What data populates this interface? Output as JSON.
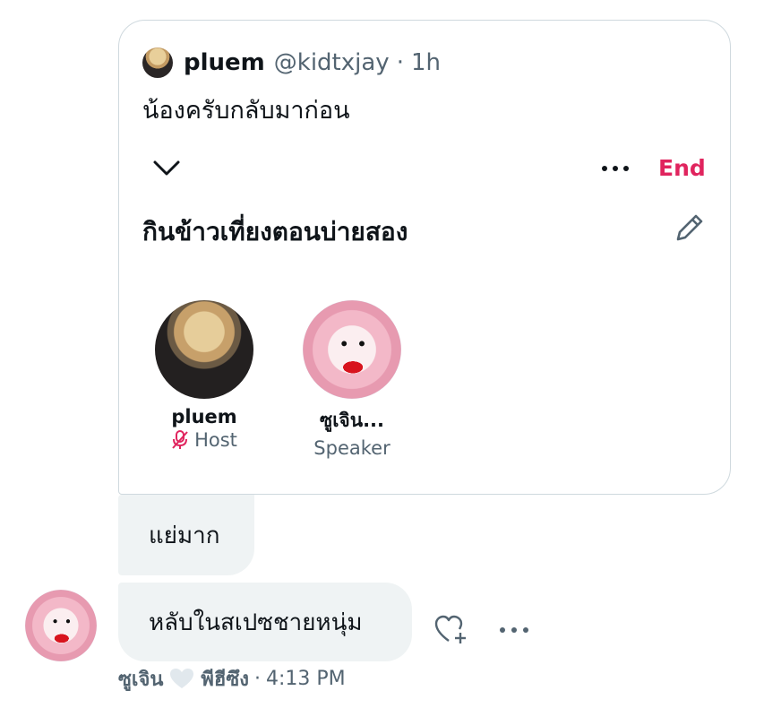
{
  "quoted_tweet": {
    "author_name": "pluem",
    "author_handle": "@kidtxjay",
    "separator": "·",
    "time": "1h",
    "text": "น้องครับกลับมาก่อน"
  },
  "space": {
    "end_label": "End",
    "title": "กินข้าวเที่ยงตอนบ่ายสอง",
    "participants": [
      {
        "name": "pluem",
        "role": "Host",
        "muted": true
      },
      {
        "name": "ซูเจิน...",
        "role": "Speaker"
      }
    ]
  },
  "messages": [
    {
      "text": "แย่มาก"
    },
    {
      "text": "หลับในสเปซชายหนุ่ม"
    }
  ],
  "meta": {
    "sender": "ซูเจิน",
    "reactor": "พีฮีซึง",
    "separator": "·",
    "time": "4:13 PM"
  },
  "colors": {
    "accent_end": "#e0245e",
    "muted_mic": "#e0245e",
    "secondary_text": "#536471",
    "bubble_bg": "#eff3f4",
    "card_border": "#cfd9de"
  },
  "icons": [
    "chevron-down-icon",
    "more-icon",
    "pencil-icon",
    "mic-off-icon",
    "add-reaction-icon",
    "heart-icon"
  ]
}
